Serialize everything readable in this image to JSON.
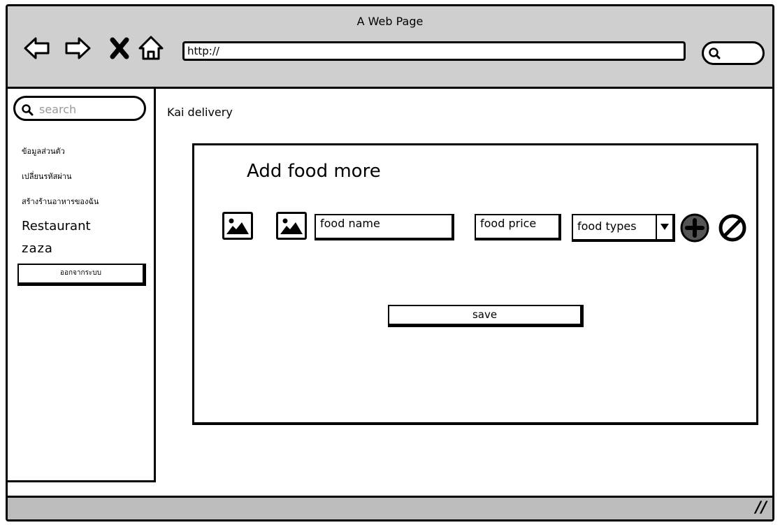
{
  "window": {
    "title": "A Web Page"
  },
  "toolbar": {
    "back_icon": "back-arrow-icon",
    "forward_icon": "forward-arrow-icon",
    "stop_icon": "close-icon",
    "home_icon": "home-icon",
    "url": "http://",
    "search_icon": "search-icon"
  },
  "sidebar": {
    "search_placeholder": "search",
    "links": [
      "ข้อมูลส่วนตัว",
      "เปลี่ยนรหัสผ่าน",
      "สร้างร้านอาหารของฉัน"
    ],
    "restaurant_label": "Restaurant",
    "restaurant_name": "zaza",
    "logout_label": "ออกจากระบบ"
  },
  "main": {
    "app_name": "Kai delivery",
    "panel": {
      "title": "Add food more",
      "food_name_placeholder": "food name",
      "food_price_placeholder": "food price",
      "food_types_value": "food types",
      "add_icon": "plus-circle-icon",
      "cancel_icon": "no-entry-icon",
      "save_label": "save"
    }
  },
  "colors": {
    "chrome": "#cfcfcf",
    "statusbar": "#bdbdbd",
    "ink": "#000000",
    "placeholder": "#999999"
  }
}
